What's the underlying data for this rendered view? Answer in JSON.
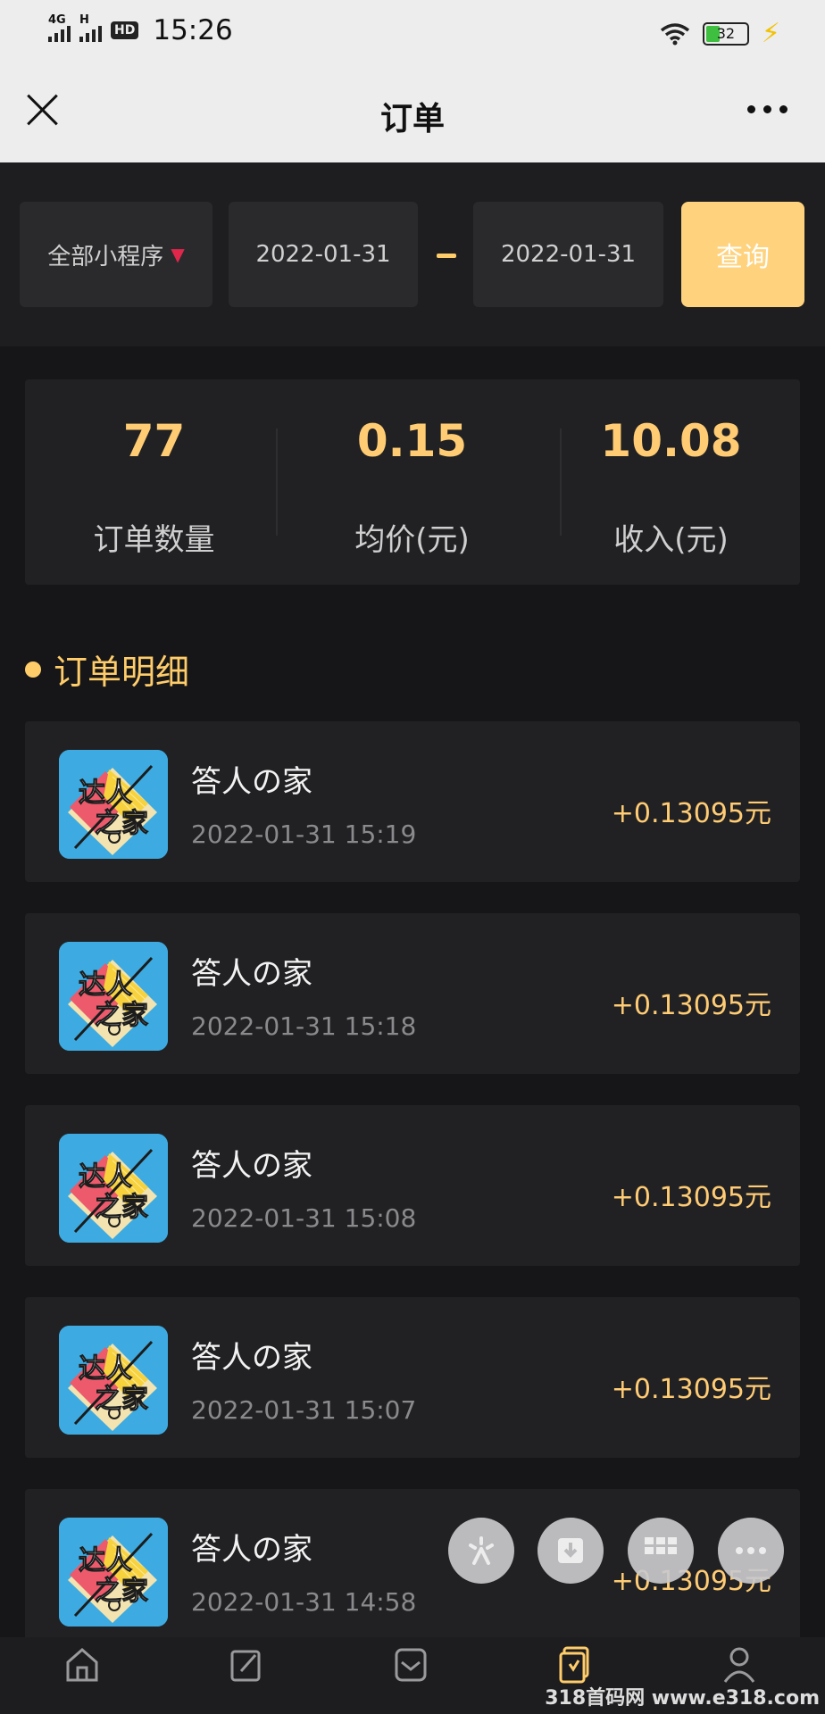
{
  "status_bar": {
    "network_1": "4G",
    "network_2": "H",
    "hd": "HD",
    "time": "15:26",
    "battery": "32"
  },
  "title_bar": {
    "title": "订单"
  },
  "filter": {
    "program_select": "全部小程序",
    "start_date": "2022-01-31",
    "end_date": "2022-01-31",
    "query_label": "查询"
  },
  "stats": [
    {
      "value": "77",
      "label": "订单数量"
    },
    {
      "value": "0.15",
      "label": "均价(元)"
    },
    {
      "value": "10.08",
      "label": "收入(元)"
    }
  ],
  "section_title": "订单明细",
  "orders": [
    {
      "name": "答人の家",
      "time": "2022-01-31 15:19",
      "amount": "+0.13095元"
    },
    {
      "name": "答人の家",
      "time": "2022-01-31 15:18",
      "amount": "+0.13095元"
    },
    {
      "name": "答人の家",
      "time": "2022-01-31 15:08",
      "amount": "+0.13095元"
    },
    {
      "name": "答人の家",
      "time": "2022-01-31 15:07",
      "amount": "+0.13095元"
    },
    {
      "name": "答人の家",
      "time": "2022-01-31 14:58",
      "amount": "+0.13095元"
    }
  ],
  "floating_actions": [
    "sparkle-icon",
    "download-icon",
    "grid-icon",
    "more-icon"
  ],
  "tabs": [
    {
      "label": "",
      "icon": "home-icon"
    },
    {
      "label": "",
      "icon": "edit-icon"
    },
    {
      "label": "",
      "icon": "invite-icon"
    },
    {
      "label": "",
      "icon": "orders-icon"
    },
    {
      "label": "",
      "icon": "user-icon"
    }
  ],
  "watermark": "318首码网 www.e318.com",
  "colors": {
    "accent": "#ffcc6a",
    "query_button": "#ffd27d",
    "background": "#161618",
    "card": "#212124"
  }
}
